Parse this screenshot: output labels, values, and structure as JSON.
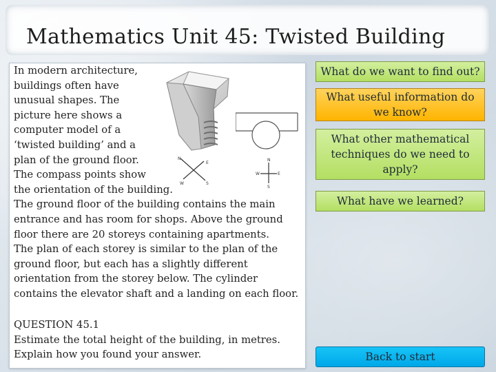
{
  "title": "Mathematics Unit 45: Twisted Building",
  "intro_lines": [
    "In modern architecture,",
    "buildings often have",
    "unusual shapes.  The",
    "picture here shows a",
    "computer model of a",
    "‘twisted building’ and a",
    "plan of the ground floor.",
    "The compass points show",
    "the orientation of the building.",
    "The ground floor of the building contains the main",
    "entrance and has room for shops.  Above the ground",
    "floor there are 20 storeys containing apartments.",
    "The plan of each storey is similar to the plan of the",
    "ground floor, but each has a slightly different",
    "orientation from the storey below.  The cylinder",
    "contains the elevator shaft and a landing on each floor."
  ],
  "question": {
    "heading": "QUESTION 45.1",
    "line1": "Estimate the total height of the building, in metres.",
    "line2": "Explain how you found your answer."
  },
  "compass_letters": {
    "north": "N",
    "east": "E",
    "south": "S",
    "west": "W"
  },
  "buttons": {
    "find_out": "What do we want to find out?",
    "useful_info": "What useful information do we know?",
    "techniques": "What other mathematical techniques do we need to apply?",
    "learned": "What have we learned?",
    "back": "Back to start"
  },
  "colors": {
    "green": "#b3df62",
    "orange": "#ffb400",
    "blue": "#00a7e8"
  }
}
